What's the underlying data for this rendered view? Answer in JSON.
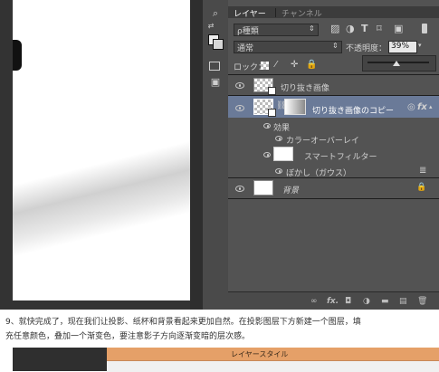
{
  "panel": {
    "tabs": [
      "レイヤー",
      "チャンネル"
    ],
    "filter_kind": "ρ種類",
    "blend_mode": "通常",
    "opacity_label": "不透明度：",
    "opacity_value": "39%",
    "lock_label": "ロック："
  },
  "layers": {
    "cutout_name": "切り抜き画像",
    "copy_name": "切り抜き画像のコピー",
    "fx_symbol": "fx",
    "effects_label": "効果",
    "color_overlay_label": "カラーオーバーレイ",
    "smart_filter_label": "スマートフィルター",
    "blur_label": "ぼかし（ガウス）",
    "background_name": "背景"
  },
  "bottom_bar": {
    "fx_label": "fx."
  },
  "caption": {
    "line1": "9、就快完成了，现在我们让投影、纸杯和背景看起来更加自然。在投影图层下方新建一个图层，填",
    "line2": "充任意颜色，叠加一个渐变色，要注意影子方向逐渐变暗的层次感。"
  },
  "dialog": {
    "title": "レイヤースタイル",
    "accent": "#e5a068"
  },
  "colors": {
    "panel_bg": "#535353",
    "dark_bg": "#282828",
    "selected_row": "#6a7a98"
  }
}
